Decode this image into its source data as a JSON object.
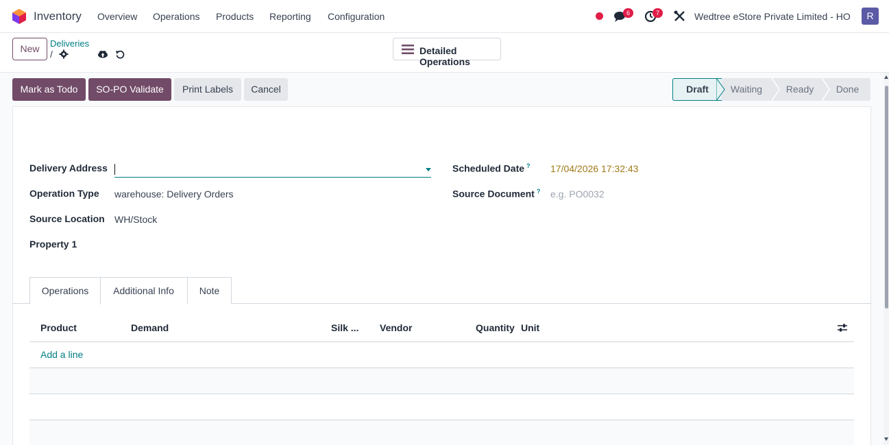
{
  "navbar": {
    "app_name": "Inventory",
    "menu": [
      "Overview",
      "Operations",
      "Products",
      "Reporting",
      "Configuration"
    ],
    "messages_count": "6",
    "activities_count": "7",
    "company": "Wedtree eStore Private Limited - HO",
    "avatar_initial": "R"
  },
  "control_panel": {
    "new_label": "New",
    "breadcrumb": "Deliveries",
    "breadcrumb_sep": "/",
    "detailed_operations_label": "Detailed Operations"
  },
  "actions": {
    "mark_todo": "Mark as Todo",
    "sopo_validate": "SO-PO Validate",
    "print_labels": "Print Labels",
    "cancel": "Cancel"
  },
  "statusbar": {
    "stages": [
      "Draft",
      "Waiting",
      "Ready",
      "Done"
    ],
    "current": "Draft"
  },
  "form": {
    "delivery_address_label": "Delivery Address",
    "delivery_address_value": "",
    "operation_type_label": "Operation Type",
    "operation_type_value": "warehouse: Delivery Orders",
    "source_location_label": "Source Location",
    "source_location_value": "WH/Stock",
    "property_label": "Property 1",
    "scheduled_date_label": "Scheduled Date",
    "scheduled_date_value": "17/04/2026 17:32:43",
    "source_document_label": "Source Document",
    "source_document_placeholder": "e.g. PO0032",
    "help_mark": "?"
  },
  "tabs": [
    "Operations",
    "Additional Info",
    "Note"
  ],
  "table": {
    "columns": [
      "Product",
      "Demand",
      "Silk ...",
      "Vendor",
      "Quantity",
      "Unit"
    ],
    "add_line": "Add a line"
  },
  "colors": {
    "primary": "#714b67",
    "accent": "#017e84",
    "date": "#a07a18",
    "badge": "#e11d48"
  }
}
